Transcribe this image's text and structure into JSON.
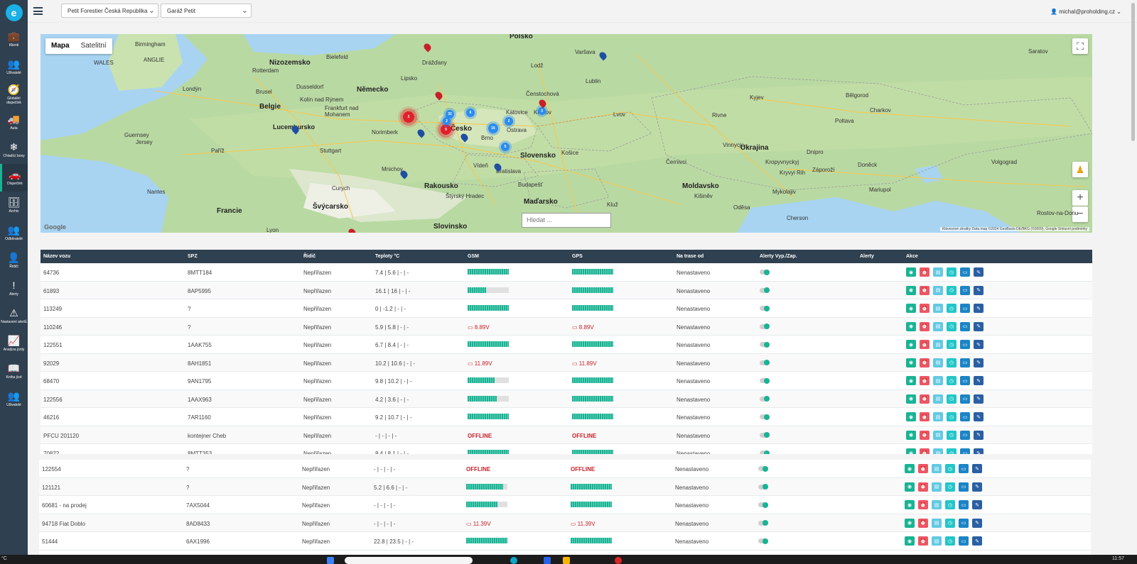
{
  "sidebar": {
    "logo": "e",
    "items": [
      {
        "label": "Klienti",
        "icon": "briefcase-icon",
        "glyph": "💼"
      },
      {
        "label": "Uživatelé",
        "icon": "users-icon",
        "glyph": "👥"
      },
      {
        "label": "Globální dispečink",
        "icon": "compass-icon",
        "glyph": "🧭"
      },
      {
        "label": "Auta",
        "icon": "truck-icon",
        "glyph": "🚚"
      },
      {
        "label": "Chladící boxy",
        "icon": "snowflake-icon",
        "glyph": "❄"
      },
      {
        "label": "Dispečink",
        "icon": "car-icon",
        "glyph": "🚗"
      },
      {
        "label": "Archiv",
        "icon": "archive-icon",
        "glyph": "🗄"
      },
      {
        "label": "Odběratelé",
        "icon": "users-icon",
        "glyph": "👥"
      },
      {
        "label": "Řidiči",
        "icon": "user-icon",
        "glyph": "👤"
      },
      {
        "label": "Alerty",
        "icon": "exclamation-icon",
        "glyph": "!"
      },
      {
        "label": "Nastavení alertů",
        "icon": "alert-settings-icon",
        "glyph": "⚠"
      },
      {
        "label": "Analýza jízdy",
        "icon": "chart-icon",
        "glyph": "📈"
      },
      {
        "label": "Kniha jízd",
        "icon": "book-icon",
        "glyph": "📖"
      },
      {
        "label": "Uživatelé",
        "icon": "users-icon",
        "glyph": "👥"
      }
    ]
  },
  "topbar": {
    "company_select": "Petit Forestier Česká Republika",
    "garage_select": "Garáž Petit",
    "user": "michal@proholding.cz"
  },
  "map": {
    "mode_map": "Mapa",
    "mode_satellite": "Satelitní",
    "search_placeholder": "Hledat ...",
    "google": "Google",
    "attribution": "Klávesové zkratky   Data map ©2024 GeoBasis-DE/BKG (©2009), Google   Smluvní podmínky",
    "countries": [
      "Polsko",
      "Nizozemsko",
      "Belgie",
      "Německo",
      "Česko",
      "Slovensko",
      "Rakousko",
      "Maďarsko",
      "Švýcarsko",
      "Francie",
      "Slovinsko",
      "Ukrajina",
      "Moldavsko",
      "Lucembursko"
    ],
    "cities": [
      "Birmingham",
      "ANGLIE",
      "WALES",
      "Londýn",
      "Guernsey",
      "Jersey",
      "Rotterdam",
      "Bielefeld",
      "Drážďany",
      "Lipsko",
      "Varšava",
      "Lodž",
      "Lublin",
      "Kyjev",
      "Charkov",
      "Poltava",
      "Dnipro",
      "Doněck",
      "Volgograd",
      "Záporoží",
      "Kryvyi Rih",
      "Mariupol",
      "Oděsa",
      "Kišiněv",
      "Lvov",
      "Katovice",
      "Ostrava",
      "Brno",
      "Vídeň",
      "Bratislava",
      "Budapešť",
      "Košice",
      "Krakov",
      "Norimberk",
      "Frankfurt nad Mohanem",
      "Mnichov",
      "Stuttgart",
      "Curych",
      "Nantes",
      "Paříž",
      "Lyon",
      "Čenstochová",
      "Dusseldorf",
      "Kolín nad Rýnem",
      "Brusel",
      "Štýrský Hradec",
      "Kluž",
      "Rostov-na-Donu",
      "Saratov",
      "Bělgorod",
      "Rivne",
      "Vinnycja",
      "Černivci",
      "Mykolajiv",
      "Cherson",
      "Kropyvnyckyj"
    ],
    "clusters": [
      {
        "color": "red",
        "label": "2"
      },
      {
        "color": "red",
        "label": "9"
      },
      {
        "color": "blue",
        "label": "32"
      },
      {
        "color": "blue",
        "label": "6"
      },
      {
        "color": "blue",
        "label": "16"
      },
      {
        "color": "blue",
        "label": "2"
      },
      {
        "color": "blue",
        "label": "3"
      },
      {
        "color": "blue",
        "label": "5"
      },
      {
        "color": "blue",
        "label": "2"
      }
    ]
  },
  "table": {
    "headers": [
      "Název vozu",
      "SPZ",
      "Řidič",
      "Teploty °C",
      "GSM",
      "GPS",
      "Na trase od",
      "Alerty Vyp./Zap.",
      "Alerty",
      "Akce"
    ],
    "rows": [
      {
        "name": "64736",
        "spz": "8MTT184",
        "driver": "Nepřiřazen",
        "temps": "7.4 | 5.6 | - | -",
        "gsm": {
          "type": "bar",
          "level": 1.0
        },
        "gps": {
          "type": "bar",
          "level": 1.0
        },
        "since": "Nenastaveno"
      },
      {
        "name": "61893",
        "spz": "8AP5995",
        "driver": "Nepřiřazen",
        "temps": "16.1 | 16 | - | -",
        "gsm": {
          "type": "bar",
          "level": 0.45
        },
        "gps": {
          "type": "bar",
          "level": 1.0
        },
        "since": "Nenastaveno"
      },
      {
        "name": "113249",
        "spz": "?",
        "driver": "Nepřiřazen",
        "temps": "0 | -1.2 | - | -",
        "gsm": {
          "type": "bar",
          "level": 1.0
        },
        "gps": {
          "type": "bar",
          "level": 1.0
        },
        "since": "Nenastaveno"
      },
      {
        "name": "110246",
        "spz": "?",
        "driver": "Nepřiřazen",
        "temps": "5.9 | 5.8 | - | -",
        "gsm": {
          "type": "battery",
          "text": "8.89V"
        },
        "gps": {
          "type": "battery",
          "text": "8.89V"
        },
        "since": "Nenastaveno"
      },
      {
        "name": "122551",
        "spz": "1AAK755",
        "driver": "Nepřiřazen",
        "temps": "6.7 | 8.4 | - | -",
        "gsm": {
          "type": "bar",
          "level": 1.0
        },
        "gps": {
          "type": "bar",
          "level": 1.0
        },
        "since": "Nenastaveno"
      },
      {
        "name": "92029",
        "spz": "8AH1851",
        "driver": "Nepřiřazen",
        "temps": "10.2 | 10.6 | - | -",
        "gsm": {
          "type": "battery",
          "text": "11.89V"
        },
        "gps": {
          "type": "battery",
          "text": "11.89V"
        },
        "since": "Nenastaveno"
      },
      {
        "name": "68470",
        "spz": "9AN1795",
        "driver": "Nepřiřazen",
        "temps": "9.8 | 10.2 | - | -",
        "gsm": {
          "type": "bar",
          "level": 0.65
        },
        "gps": {
          "type": "bar",
          "level": 1.0
        },
        "since": "Nenastaveno"
      },
      {
        "name": "122556",
        "spz": "1AAX963",
        "driver": "Nepřiřazen",
        "temps": "4.2 | 3.6 | - | -",
        "gsm": {
          "type": "bar",
          "level": 0.7
        },
        "gps": {
          "type": "bar",
          "level": 1.0
        },
        "since": "Nenastaveno"
      },
      {
        "name": "46216",
        "spz": "7AR1160",
        "driver": "Nepřiřazen",
        "temps": "9.2 | 10.7 | - | -",
        "gsm": {
          "type": "bar",
          "level": 1.0
        },
        "gps": {
          "type": "bar",
          "level": 1.0
        },
        "since": "Nenastaveno"
      },
      {
        "name": "PFCU 201120",
        "spz": "kontejner Cheb",
        "driver": "Nepřiřazen",
        "temps": "- | - | - | -",
        "gsm": {
          "type": "offline",
          "text": "OFFLINE"
        },
        "gps": {
          "type": "offline",
          "text": "OFFLINE"
        },
        "since": "Nenastaveno"
      },
      {
        "name": "70822",
        "spz": "8MTT353",
        "driver": "Nepřiřazen",
        "temps": "8.4 | 8.1 | - | -",
        "gsm": {
          "type": "bar",
          "level": 1.0
        },
        "gps": {
          "type": "bar",
          "level": 1.0
        },
        "since": "Nenastaveno"
      }
    ],
    "rows2": [
      {
        "name": "122554",
        "spz": "?",
        "driver": "Nepřiřazen",
        "temps": "- | - | - | -",
        "gsm": {
          "type": "offline",
          "text": "OFFLINE"
        },
        "gps": {
          "type": "offline",
          "text": "OFFLINE"
        },
        "since": "Nenastaveno"
      },
      {
        "name": "121121",
        "spz": "?",
        "driver": "Nepřiřazen",
        "temps": "5.2 | 6.6 | - | -",
        "gsm": {
          "type": "bar",
          "level": 0.9
        },
        "gps": {
          "type": "bar",
          "level": 1.0
        },
        "since": "Nenastaveno"
      },
      {
        "name": "60681 - na prodej",
        "spz": "7AX5044",
        "driver": "Nepřiřazen",
        "temps": "- | - | - | -",
        "gsm": {
          "type": "bar",
          "level": 0.75
        },
        "gps": {
          "type": "bar",
          "level": 1.0
        },
        "since": "Nenastaveno"
      },
      {
        "name": "94718 Fiat Doblo",
        "spz": "8AD8433",
        "driver": "Nepřiřazen",
        "temps": "- | - | - | -",
        "gsm": {
          "type": "battery",
          "text": "11.39V"
        },
        "gps": {
          "type": "battery",
          "text": "11.39V"
        },
        "since": "Nenastaveno"
      },
      {
        "name": "51444",
        "spz": "6AX1996",
        "driver": "Nepřiřazen",
        "temps": "22.8 | 23.5 | - | -",
        "gsm": {
          "type": "bar",
          "level": 1.0
        },
        "gps": {
          "type": "bar",
          "level": 1.0
        },
        "since": "Nenastaveno"
      }
    ]
  },
  "taskbar": {
    "left": "°C",
    "time": "11:57"
  },
  "colors": {
    "sidebar": "#2f4050",
    "accent": "#1ab394",
    "danger": "#c8202a"
  }
}
